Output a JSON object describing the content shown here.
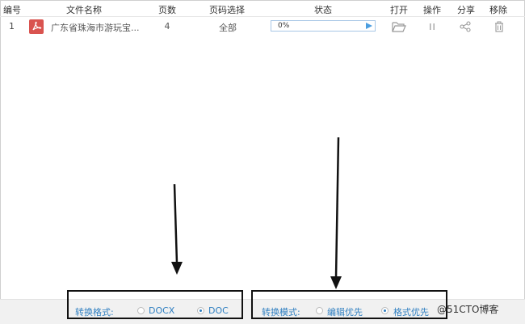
{
  "table": {
    "headers": {
      "no": "编号",
      "filename": "文件名称",
      "pages": "页数",
      "page_select": "页码选择",
      "status": "状态",
      "open": "打开",
      "operate": "操作",
      "share": "分享",
      "remove": "移除"
    },
    "rows": [
      {
        "no": "1",
        "filename": "广东省珠海市游玩宝...",
        "pages": "4",
        "page_select": "全部",
        "progress_text": "0%",
        "progress": 0
      }
    ]
  },
  "bottom": {
    "format_label": "转换格式:",
    "format_options": [
      "DOCX",
      "DOC"
    ],
    "format_selected": "DOC",
    "mode_label": "转换模式:",
    "mode_options": [
      "编辑优先",
      "格式优先"
    ],
    "mode_selected": "格式优先"
  },
  "watermark": "@51CTO博客",
  "colors": {
    "accent": "#2f7fc1",
    "pdf_red": "#d9534f",
    "progress_border": "#a8c7e6"
  },
  "icons": [
    "pdf-icon",
    "play-icon",
    "folder-icon",
    "pause-icon",
    "share-icon",
    "trash-icon"
  ]
}
